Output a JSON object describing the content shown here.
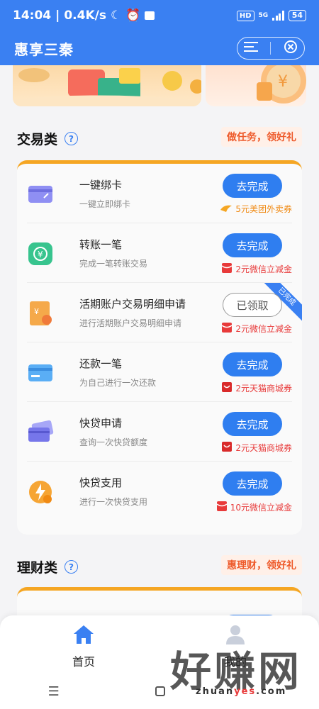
{
  "status_bar": {
    "time": "14:04",
    "speed": "0.4K/s",
    "hd": "HD",
    "network": "5G",
    "battery": "54"
  },
  "header": {
    "title": "惠享三秦"
  },
  "sections": [
    {
      "title": "交易类",
      "promo": "做任务，领好礼",
      "tasks": [
        {
          "name": "一键绑卡",
          "desc": "一键立即绑卡",
          "button": "去完成",
          "reward": "5元美团外卖券",
          "icon": "card-icon"
        },
        {
          "name": "转账一笔",
          "desc": "完成一笔转账交易",
          "button": "去完成",
          "reward": "2元微信立减金",
          "icon": "transfer-icon"
        },
        {
          "name": "活期账户交易明细申请",
          "desc": "进行活期账户交易明细申请",
          "button": "已领取",
          "reward": "2元微信立减金",
          "ribbon": "已完成",
          "icon": "document-icon"
        },
        {
          "name": "还款一笔",
          "desc": "为自己进行一次还款",
          "button": "去完成",
          "reward": "2元天猫商城券",
          "icon": "repay-icon"
        },
        {
          "name": "快贷申请",
          "desc": "查询一次快贷额度",
          "button": "去完成",
          "reward": "2元天猫商城券",
          "icon": "cards-icon"
        },
        {
          "name": "快贷支用",
          "desc": "进行一次快贷支用",
          "button": "去完成",
          "reward": "10元微信立减金",
          "icon": "lightning-coin-icon"
        }
      ]
    },
    {
      "title": "理财类",
      "promo": "惠理财，领好礼"
    }
  ],
  "bottom_nav": {
    "home": "首页",
    "mine": "我的"
  },
  "watermark": {
    "text": "好赚网",
    "url_pre": "zhuan",
    "url_mid": "yes",
    "url_post": ".com"
  },
  "colors": {
    "primary": "#3a80f2",
    "accent": "#f5a623",
    "promo": "#ee5a2b"
  }
}
